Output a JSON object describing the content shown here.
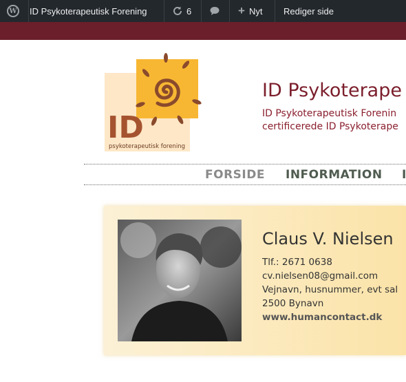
{
  "admin_bar": {
    "site_name": "ID Psykoterapeutisk Forening",
    "updates_count": "6",
    "new_label": "Nyt",
    "edit_label": "Rediger side",
    "icons": [
      "wordpress-logo-icon",
      "home-icon",
      "refresh-icon",
      "comment-icon",
      "plus-icon"
    ]
  },
  "logo": {
    "letters": "ID",
    "tagline": "psykoterapeutisk forening"
  },
  "header": {
    "title": "ID Psykoterape",
    "description_line1": "ID Psykoterapeutisk Forenin",
    "description_line2": "certificerede ID Psykoterape"
  },
  "menu": {
    "items": [
      {
        "label": "FORSIDE",
        "color": "#8a8a8a"
      },
      {
        "label": "INFORMATION",
        "color": "#4f5b4f"
      },
      {
        "label": "I",
        "color": "#4f5b4f"
      }
    ]
  },
  "profile": {
    "name": "Claus V. Nielsen",
    "phone": "Tlf.: 2671 0638",
    "email": "cv.nielsen08@gmail.com",
    "address": "Vejnavn, husnummer, evt sal",
    "city": "2500 Bynavn",
    "website": "www.humancontact.dk"
  },
  "colors": {
    "admin_bar": "#23282d",
    "brand_band": "#6b1f2a",
    "title": "#7b1e2c",
    "card_start": "#fcf1d6",
    "card_end": "#fbe3a8",
    "logo_sun": "#f7b733",
    "logo_spiral": "#8a4a2c"
  }
}
